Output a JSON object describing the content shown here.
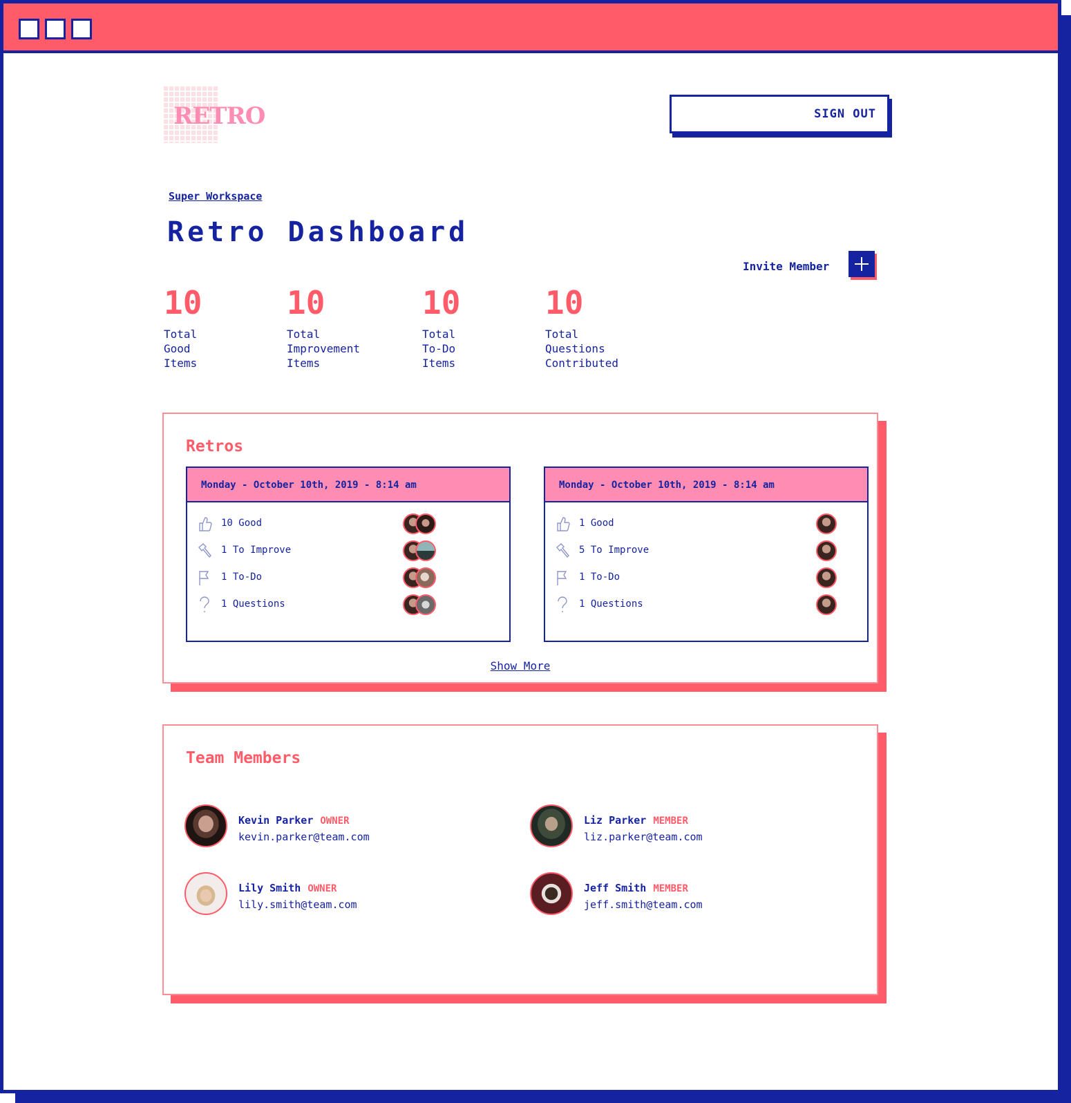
{
  "logo": {
    "text": "RETRO"
  },
  "header": {
    "signout_label": "SIGN OUT"
  },
  "breadcrumb": "Super Workspace",
  "title": "Retro Dashboard",
  "invite_label": "Invite Member",
  "stats": [
    {
      "value": "10",
      "label": "Total Good Items"
    },
    {
      "value": "10",
      "label": "Total Improvement Items"
    },
    {
      "value": "10",
      "label": "Total To-Do Items"
    },
    {
      "value": "10",
      "label": "Total Questions Contributed"
    }
  ],
  "retros": {
    "title": "Retros",
    "show_more": "Show More",
    "cards": [
      {
        "date": "Monday - October 10th, 2019 - 8:14 am",
        "rows": [
          {
            "icon": "thumbs-up-icon",
            "text": "10 Good"
          },
          {
            "icon": "hammer-icon",
            "text": "1 To Improve"
          },
          {
            "icon": "flag-icon",
            "text": "1 To-Do"
          },
          {
            "icon": "question-icon",
            "text": "1 Questions"
          }
        ]
      },
      {
        "date": "Monday - October 10th, 2019 - 8:14 am",
        "rows": [
          {
            "icon": "thumbs-up-icon",
            "text": "1 Good"
          },
          {
            "icon": "hammer-icon",
            "text": "5 To Improve"
          },
          {
            "icon": "flag-icon",
            "text": "1 To-Do"
          },
          {
            "icon": "question-icon",
            "text": "1 Questions"
          }
        ]
      }
    ]
  },
  "team": {
    "title": "Team Members",
    "members": [
      {
        "name": "Kevin Parker",
        "role": "OWNER",
        "email": "kevin.parker@team.com"
      },
      {
        "name": "Liz Parker",
        "role": "MEMBER",
        "email": "liz.parker@team.com"
      },
      {
        "name": "Lily Smith",
        "role": "OWNER",
        "email": "lily.smith@team.com"
      },
      {
        "name": "Jeff Smith",
        "role": "MEMBER",
        "email": "jeff.smith@team.com"
      }
    ]
  },
  "colors": {
    "accent": "#ff5b69",
    "primary": "#1523a0",
    "pink": "#ff8db3"
  }
}
